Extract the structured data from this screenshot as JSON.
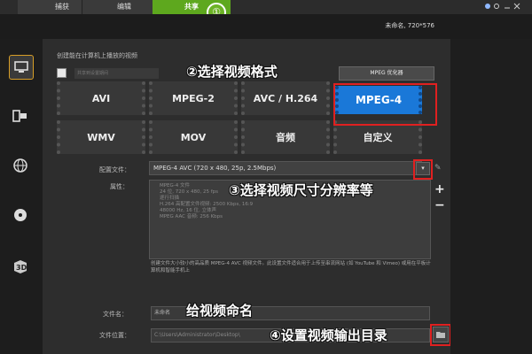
{
  "tabs": [
    {
      "label": "捕获"
    },
    {
      "label": "编辑"
    },
    {
      "label": "共享"
    }
  ],
  "annotations": {
    "step1": "①",
    "step2": "②选择视频格式",
    "step3": "③选择视频尺寸分辨率等",
    "step_name": "给视频命名",
    "step4": "④设置视频输出目录"
  },
  "project_info": "未命名, 720*576",
  "section_title": "创建能在计算机上播放的视频",
  "checkbox_label": "共享到设置期间",
  "optimizer_button": "MPEG 优化器",
  "formats": [
    "AVI",
    "MPEG-2",
    "AVC / H.264",
    "MPEG-4",
    "WMV",
    "MOV",
    "音频",
    "自定义"
  ],
  "selected_format": "MPEG-4",
  "profile": {
    "label": "配置文件：",
    "value": "MPEG-4 AVC (720 x 480, 25p, 2.5Mbps)"
  },
  "attributes": {
    "label": "属性：",
    "lines": [
      "MPEG-4 文件",
      "24 位, 720 x 480, 25 fps",
      "逐行扫描",
      "H.264 高配置文件视频: 2500 Kbps, 16:9",
      "48000 Hz, 16 位, 立体声",
      "MPEG AAC 音频: 256 Kbps"
    ]
  },
  "description": "创建文件大小较小的高品质 MPEG-4 AVC 视频文件。此设置文件适合用于上传至串流网站 (如 YouTube 和 Vimeo) 或用在平板计算机和智能手机上",
  "filename": {
    "label": "文件名：",
    "value": "未命名"
  },
  "location": {
    "label": "文件位置：",
    "value": "C:\\Users\\Administrator\\Desktop\\"
  },
  "icons": [
    "computer-icon",
    "device-icon",
    "globe-icon",
    "disc-icon",
    "3d-icon",
    "pencil-icon",
    "plus-icon",
    "minus-icon",
    "folder-icon"
  ],
  "colors": {
    "accent_green": "#5ea81e",
    "selected_blue": "#1a78d8",
    "annotation_red": "#e02020"
  }
}
